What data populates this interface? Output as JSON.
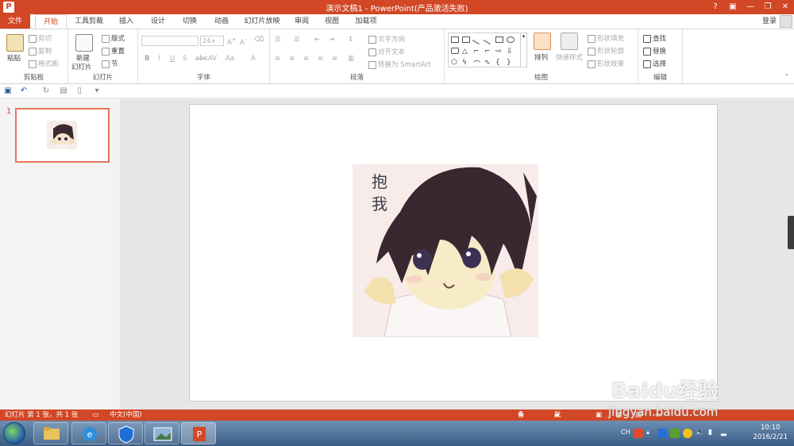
{
  "window": {
    "title": "演示文稿1 - PowerPoint(产品激活失败)",
    "app_icon": "P",
    "help": "?",
    "ribbon_display": "▣",
    "minimize": "—",
    "restore": "❐",
    "close": "✕"
  },
  "tabs": [
    "文件",
    "开始",
    "工具剪裁",
    "插入",
    "设计",
    "切换",
    "动画",
    "幻灯片放映",
    "审阅",
    "视图",
    "加载项"
  ],
  "account": {
    "login": "登录"
  },
  "ribbon": {
    "clipboard": {
      "label": "剪贴板",
      "paste": "粘贴",
      "cut": "剪切",
      "copy": "复制",
      "format_painter": "格式刷"
    },
    "slides": {
      "label": "幻灯片",
      "new_slide": "新建",
      "new_slide_2": "幻灯片",
      "layout": "版式",
      "reset": "重置",
      "section": "节"
    },
    "font": {
      "label": "字体",
      "font_name": "",
      "font_size": "24+",
      "bold": "B",
      "italic": "I",
      "underline": "U",
      "strike": "S",
      "case": "Aa"
    },
    "paragraph": {
      "label": "段落",
      "text_direction": "文字方向",
      "align_text": "对齐文本",
      "convert_smartart": "转换为 SmartArt"
    },
    "drawing": {
      "label": "绘图",
      "arrange": "排列",
      "quick_styles": "快速样式",
      "shape_fill": "形状填充",
      "shape_outline": "形状轮廓",
      "shape_effects": "形状效果"
    },
    "editing": {
      "label": "编辑",
      "find": "查找",
      "replace": "替换",
      "select": "选择"
    }
  },
  "thumbnails": {
    "slide_number": "1"
  },
  "slide": {
    "picture_text": "抱\n我"
  },
  "statusbar": {
    "slide_info": "幻灯片 第 1 张，共 1 张",
    "language": "中文(中国)",
    "notes": "备注",
    "comments": "批注"
  },
  "taskbar": {
    "input_method": "CH",
    "time": "10:10",
    "date": "2016/2/21"
  },
  "watermark": {
    "brand": "Baidu经验",
    "url": "jingyan.baidu.com"
  },
  "colors": {
    "accent": "#d24726",
    "taskbar": "#3a5c83"
  }
}
